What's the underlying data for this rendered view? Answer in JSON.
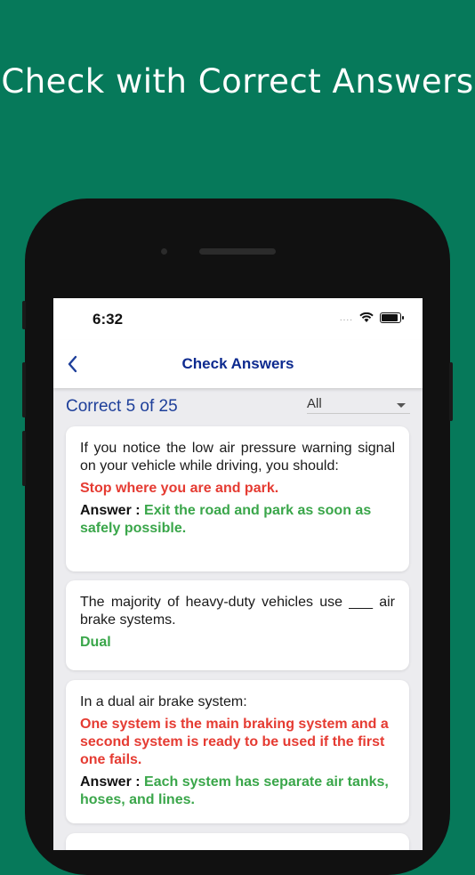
{
  "headline": "Check with Correct Answers",
  "status_bar": {
    "time": "6:32",
    "signal": "....",
    "wifi_icon": "wifi-icon",
    "battery_icon": "battery-icon"
  },
  "navbar": {
    "back_icon": "chevron-left-icon",
    "title": "Check Answers"
  },
  "summary": {
    "text": "Correct 5 of 25"
  },
  "filter": {
    "selected": "All"
  },
  "questions": [
    {
      "question": "If you notice the low air pressure warning signal on your vehicle while driving, you should:",
      "user_answer": "Stop where you are and park.",
      "answer_label": "Answer :",
      "correct_answer": "Exit the road and park as soon as safely possible."
    },
    {
      "question": "The majority of heavy-duty vehicles use ___ air brake systems.",
      "user_answer": "Dual"
    },
    {
      "question": "In a dual air brake system:",
      "user_answer": "One system is the main braking system and a second system is ready to be used if the first one fails.",
      "answer_label": "Answer :",
      "correct_answer": "Each system has separate air tanks, hoses, and lines."
    }
  ],
  "colors": {
    "background": "#06795a",
    "wrong": "#e53b32",
    "correct": "#3aa64a",
    "nav": "#0d2a8f"
  }
}
